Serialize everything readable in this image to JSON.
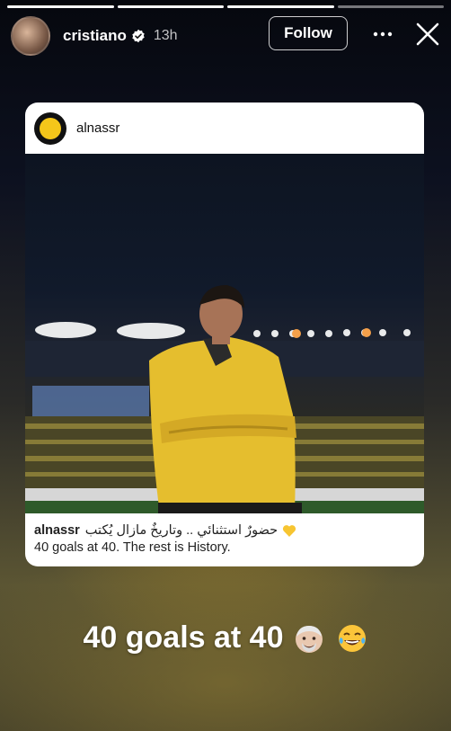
{
  "story": {
    "progress_total": 4,
    "progress_active_index": 3
  },
  "header": {
    "username": "cristiano",
    "timestamp": "13h",
    "follow_label": "Follow",
    "icons": [
      "verified-badge-icon",
      "more-options-icon",
      "close-icon"
    ]
  },
  "post": {
    "username": "alnassr",
    "caption_user": "alnassr",
    "caption_arabic": "حضورٌ استثنائي .. وتاريخٌ مازال يُكتب",
    "caption_english": "40 goals at 40. The rest is History.",
    "caption_emoji": "yellow-heart-icon"
  },
  "overlay": {
    "text": "40 goals at 40",
    "emojis": [
      "old-man-face-icon",
      "tears-of-joy-icon"
    ]
  },
  "colors": {
    "accent_yellow": "#f4c61a",
    "text_white": "#ffffff"
  }
}
